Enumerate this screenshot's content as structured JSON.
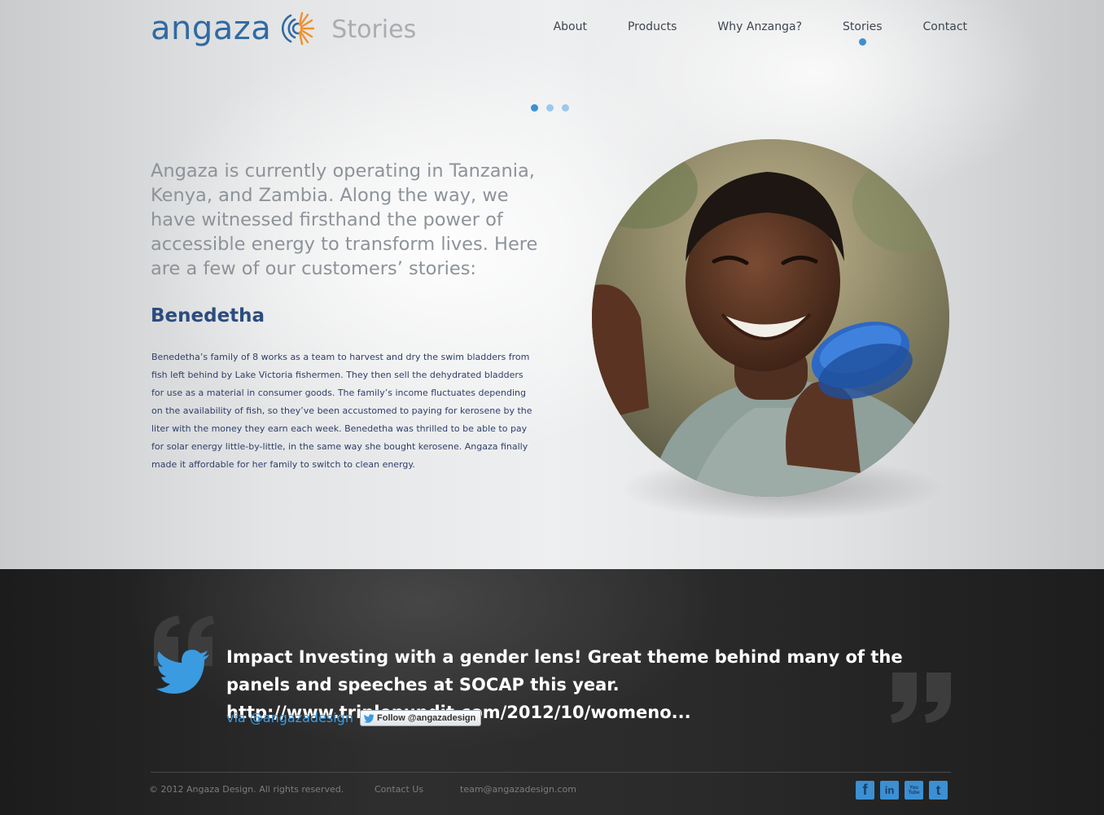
{
  "header": {
    "logo_text": "angaza",
    "section_title": "Stories",
    "nav": [
      {
        "label": "About",
        "active": false
      },
      {
        "label": "Products",
        "active": false
      },
      {
        "label": "Why Anzanga?",
        "active": false
      },
      {
        "label": "Stories",
        "active": true
      },
      {
        "label": "Contact",
        "active": false
      }
    ]
  },
  "slider": {
    "dot_count": 3,
    "active_index": 0
  },
  "main": {
    "intro": "Angaza is currently operating in Tanzania, Kenya, and Zambia. Along the way, we have witnessed firsthand the power of accessible energy to transform lives. Here are a few of our customers’ stories:",
    "story_name": "Benedetha",
    "story_text": "Benedetha’s family of 8 works as a team to harvest and dry the swim bladders from fish left behind by Lake Victoria fishermen. They then sell the dehydrated bladders for use as a material in consumer goods. The family’s income fluctuates depending on the availability of fish, so they’ve been accustomed to paying for kerosene by the liter with the money they earn each week. Benedetha was thrilled to be able to pay for solar energy little-by-little, in the same way she bought kerosene. Angaza finally made it affordable for her family to switch to clean energy."
  },
  "twitter": {
    "tweet": "Impact Investing with a gender lens! Great theme behind many of the panels and speeches at SOCAP this year. http://www.triplepundit.com/2012/10/womeno...",
    "via": "via @angazadesign",
    "follow_label": "Follow @angazadesign"
  },
  "footer": {
    "copyright": "© 2012 Angaza Design. All rights reserved.",
    "contact_link": "Contact Us",
    "email": "team@angazadesign.com",
    "social": [
      {
        "icon": "facebook-icon",
        "glyph": "f"
      },
      {
        "icon": "linkedin-icon",
        "glyph": "in"
      },
      {
        "icon": "youtube-icon",
        "glyph": "You Tube"
      },
      {
        "icon": "tumblr-icon",
        "glyph": "t"
      }
    ]
  },
  "colors": {
    "brand_blue": "#2f6aa3",
    "accent_blue": "#3b8fd3",
    "accent_orange": "#f0902c",
    "dark_bg": "#2b2b2b"
  }
}
